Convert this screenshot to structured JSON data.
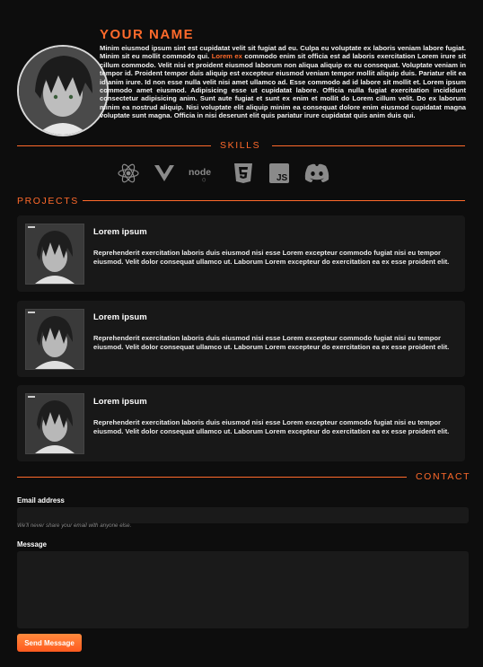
{
  "profile": {
    "name": "YOUR NAME",
    "bio_part1": "Minim eiusmod ipsum sint est cupidatat velit sit fugiat ad eu. Culpa eu voluptate ex laboris veniam labore fugiat. Minim sit eu mollit commodo qui. ",
    "bio_highlight": "Lorem ex",
    "bio_part2": " commodo enim sit officia est ad laboris exercitation Lorem irure sit cillum commodo. Velit nisi et proident eiusmod laborum non aliqua aliquip ex eu consequat. Voluptate veniam in tempor id. Proident tempor duis aliquip est excepteur eiusmod veniam tempor mollit aliquip duis. Pariatur elit ea id anim irure. Id non esse nulla velit nisi amet ullamco ad. Esse commodo ad id labore sit mollit et. Lorem ipsum commodo amet eiusmod. Adipisicing esse ut cupidatat labore. Officia nulla fugiat exercitation incididunt consectetur adipisicing anim. Sunt aute fugiat et sunt ex enim et mollit do Lorem cillum velit. Do ex laborum minim ea nostrud aliquip. Nisi voluptate elit aliquip minim ea consequat dolore enim eiusmod cupidatat magna voluptate sunt magna. Officia in nisi deserunt elit quis pariatur irure cupidatat quis anim duis qui."
  },
  "skills": {
    "title": "SKILLS",
    "icons": [
      "react-icon",
      "vue-icon",
      "node-icon",
      "html5-icon",
      "js-icon",
      "discord-icon"
    ]
  },
  "projects": {
    "title": "PROJECTS",
    "items": [
      {
        "title": "Lorem ipsum",
        "desc": "Reprehenderit exercitation laboris duis eiusmod nisi esse Lorem excepteur commodo fugiat nisi eu tempor eiusmod. Velit dolor consequat ullamco ut. Laborum Lorem excepteur do exercitation ea ex esse proident elit."
      },
      {
        "title": "Lorem ipsum",
        "desc": "Reprehenderit exercitation laboris duis eiusmod nisi esse Lorem excepteur commodo fugiat nisi eu tempor eiusmod. Velit dolor consequat ullamco ut. Laborum Lorem excepteur do exercitation ea ex esse proident elit."
      },
      {
        "title": "Lorem ipsum",
        "desc": "Reprehenderit exercitation laboris duis eiusmod nisi esse Lorem excepteur commodo fugiat nisi eu tempor eiusmod. Velit dolor consequat ullamco ut. Laborum Lorem excepteur do exercitation ea ex esse proident elit."
      }
    ]
  },
  "contact": {
    "title": "CONTACT",
    "email_label": "Email address",
    "email_hint": "We'll never share your email with anyone else.",
    "message_label": "Message",
    "send_label": "Send Message"
  },
  "colors": {
    "accent": "#ff6a2b",
    "background": "#0d0d0d",
    "card": "#181818"
  }
}
